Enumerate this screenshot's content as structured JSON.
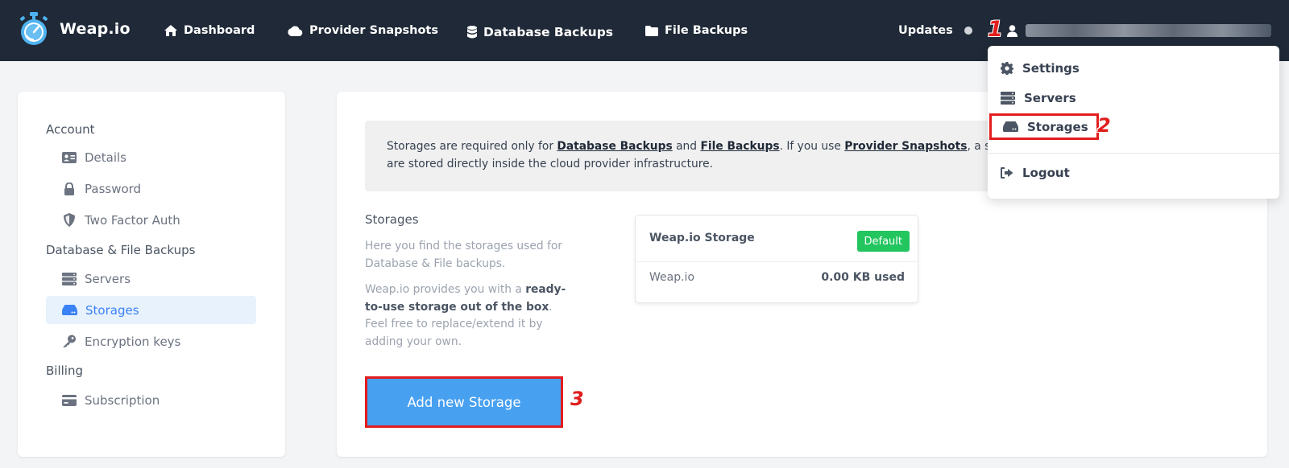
{
  "app": {
    "brand": "Weap.io"
  },
  "nav": {
    "items": [
      {
        "label": "Dashboard",
        "icon": "home-icon"
      },
      {
        "label": "Provider Snapshots",
        "icon": "cloud-icon"
      },
      {
        "label": "Database Backups",
        "icon": "database-icon"
      },
      {
        "label": "File Backups",
        "icon": "folder-icon"
      }
    ],
    "updates_label": "Updates"
  },
  "markers": [
    "1",
    "2",
    "3"
  ],
  "user_menu": {
    "items": [
      {
        "label": "Settings",
        "icon": "gear-icon"
      },
      {
        "label": "Servers",
        "icon": "servers-icon"
      },
      {
        "label": "Storages",
        "icon": "storage-icon"
      },
      {
        "label": "Logout",
        "icon": "logout-icon"
      }
    ]
  },
  "sidebar": {
    "sections": [
      {
        "heading": "Account",
        "items": [
          {
            "label": "Details",
            "icon": "id-card-icon"
          },
          {
            "label": "Password",
            "icon": "lock-icon"
          },
          {
            "label": "Two Factor Auth",
            "icon": "shield-icon"
          }
        ]
      },
      {
        "heading": "Database & File Backups",
        "items": [
          {
            "label": "Servers",
            "icon": "servers-icon"
          },
          {
            "label": "Storages",
            "icon": "storage-icon",
            "active": true
          },
          {
            "label": "Encryption keys",
            "icon": "key-icon"
          }
        ]
      },
      {
        "heading": "Billing",
        "items": [
          {
            "label": "Subscription",
            "icon": "credit-card-icon"
          }
        ]
      }
    ]
  },
  "info": {
    "text_1": "Storages are required only for ",
    "link_1": "Database Backups",
    "text_2": " and ",
    "link_2": "File Backups",
    "text_3": ". If you use ",
    "link_3": "Provider Snapshots",
    "text_4": ", a storage is",
    "text_5": "are stored directly inside the cloud provider infrastructure."
  },
  "storages": {
    "title": "Storages",
    "desc_1": "Here you find the storages used for Database & File backups.",
    "desc_2_pre": "Weap.io provides you with a ",
    "desc_2_bold": "ready-to-use storage out of the box",
    "desc_2_post": ". Feel free to replace/extend it by adding your own.",
    "add_button": "Add new Storage"
  },
  "storage_card": {
    "name": "Weap.io Storage",
    "badge": "Default",
    "provider": "Weap.io",
    "used": "0.00 KB used"
  },
  "colors": {
    "nav_bg": "#1f2937",
    "accent": "#3b82f6",
    "button": "#48a0f0",
    "badge": "#22c55e",
    "annotation": "#e11d1d"
  }
}
